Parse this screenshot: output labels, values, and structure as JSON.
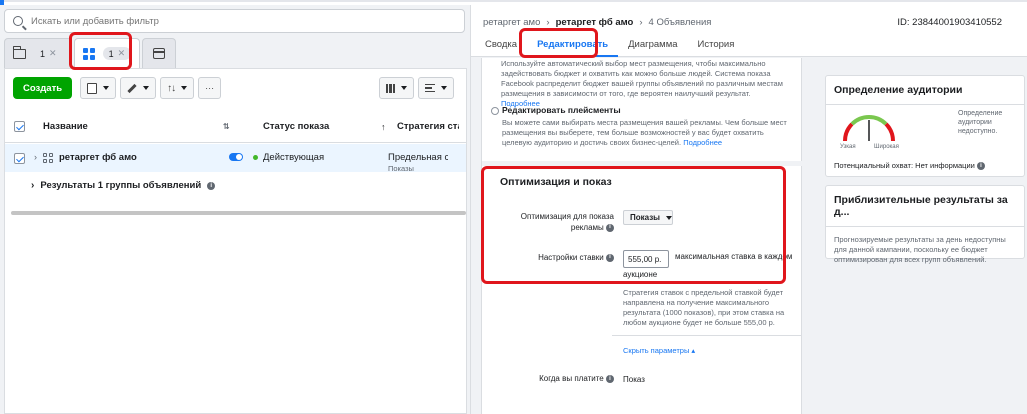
{
  "search": {
    "placeholder": "Искать или добавить фильтр"
  },
  "levels": {
    "campaigns_count": "1",
    "adsets_count": "1"
  },
  "toolbar": {
    "create_label": "Создать"
  },
  "table": {
    "headers": {
      "name": "Название",
      "status": "Статус показа",
      "strategy": "Стратегия ставок"
    },
    "row": {
      "name": "ретаргет фб амо",
      "status": "Действующая",
      "strategy_line1": "Предельная ставка",
      "strategy_line2": "Показы"
    },
    "results_label": "Результаты 1 группы объявлений"
  },
  "header": {
    "breadcrumb": {
      "campaign": "ретаргет амо",
      "adset": "ретаргет фб амо",
      "ads": "4 Объявления"
    },
    "id_text": "ID: 23844001903410552",
    "tabs": [
      {
        "label": "Сводка"
      },
      {
        "label": "Редактировать"
      },
      {
        "label": "Диаграмма"
      },
      {
        "label": "История"
      }
    ]
  },
  "edit": {
    "auto_placements_text": "Используйте автоматический выбор мест размещения, чтобы максимально задействовать бюджет и охватить как можно больше людей. Система показа Facebook распределит бюджет вашей группы объявлений по различным местам размещения в зависимости от того, где вероятен наилучший результат.",
    "more_link": "Подробнее",
    "edit_placements_label": "Редактировать плейсменты",
    "edit_placements_text": "Вы можете сами выбирать места размещения вашей рекламы. Чем больше мест размещения вы выберете, тем больше возможностей у вас будет охватить целевую аудиторию и достичь своих бизнес-целей.",
    "optimization": {
      "title": "Оптимизация и показ",
      "opt_label_line1": "Оптимизация для показа",
      "opt_label_line2": "рекламы",
      "opt_value": "Показы",
      "bid_label": "Настройки ставки",
      "bid_value": "555,00 р.",
      "bid_suffix_line1": "максимальная ставка в каждом",
      "bid_suffix_line2": "аукционе",
      "bid_note": "Стратегия ставок с предельной ставкой будет направлена на получение максимального результата (1000 показов), при этом ставка на любом аукционе будет не больше 555,00 р.",
      "hide_params": "Скрыть параметры ▴",
      "pay_label": "Когда вы платите",
      "pay_value": "Показ"
    }
  },
  "audience": {
    "title": "Определение аудитории",
    "narrow": "Узкая",
    "broad": "Широкая",
    "note": "Определение аудитории недоступно.",
    "potential": "Потенциальный охват: Нет информации"
  },
  "estimate": {
    "title": "Приблизительные результаты за д...",
    "text": "Прогнозируемые результаты за день недоступны для данной кампании, поскольку ее бюджет оптимизирован для всех групп объявлений."
  },
  "colors": {
    "accent": "#1877f2",
    "create": "#00a400",
    "highlight": "#e0161c"
  }
}
